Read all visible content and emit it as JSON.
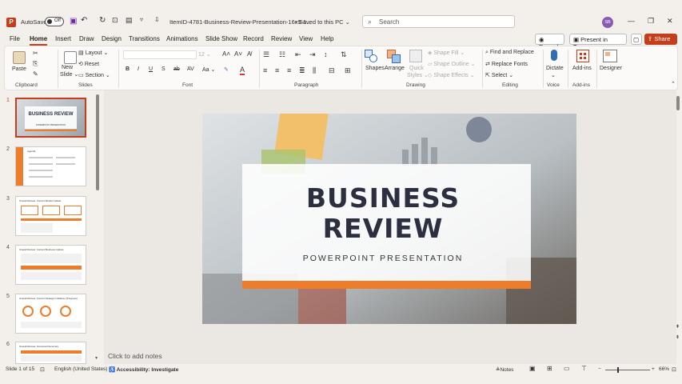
{
  "titlebar": {
    "autosave": "AutoSave",
    "toggle": "Off",
    "filename": "ItemID-4781-Business-Review-Presentation-16x9-1...",
    "saved": "Saved to this PC",
    "search_placeholder": "Search",
    "avatar": "SB"
  },
  "menu": [
    "File",
    "Home",
    "Insert",
    "Draw",
    "Design",
    "Transitions",
    "Animations",
    "Slide Show",
    "Record",
    "Review",
    "View",
    "Help"
  ],
  "actions": {
    "record": "Record",
    "present": "Present in Teams",
    "share": "Share"
  },
  "ribbon": {
    "paste": "Paste",
    "new_slide_1": "New",
    "new_slide_2": "Slide",
    "layout": "Layout",
    "reset": "Reset",
    "section": "Section",
    "font_size": "12",
    "shapes": "Shapes",
    "arrange": "Arrange",
    "quick_styles_1": "Quick",
    "quick_styles_2": "Styles",
    "shape_fill": "Shape Fill",
    "shape_outline": "Shape Outline",
    "shape_effects": "Shape Effects",
    "find_replace": "Find and Replace",
    "replace_fonts": "Replace Fonts",
    "select": "Select",
    "dictate": "Dictate",
    "addins": "Add-ins",
    "designer": "Designer",
    "groups": {
      "clipboard": "Clipboard",
      "slides": "Slides",
      "font": "Font",
      "paragraph": "Paragraph",
      "drawing": "Drawing",
      "editing": "Editing",
      "voice": "Voice",
      "addins": "Add-ins"
    }
  },
  "thumbnails": [
    {
      "num": "1",
      "title": "BUSINESS REVIEW",
      "subtitle": "POWERPOINT PRESENTATION"
    },
    {
      "num": "2",
      "title": "Agenda"
    },
    {
      "num": "3",
      "title": "Overall Review: Current Market Update"
    },
    {
      "num": "4",
      "title": "Overall Review: Current Business Update"
    },
    {
      "num": "5",
      "title": "Overall Review: Current Strategic Initiatives (Progress)"
    },
    {
      "num": "6",
      "title": "Overall Review: Scorecard Summary"
    }
  ],
  "slide": {
    "title_line1": "BUSINESS",
    "title_line2": "REVIEW",
    "subtitle": "POWERPOINT PRESENTATION"
  },
  "notes_placeholder": "Click to add notes",
  "status": {
    "slide_of": "Slide 1 of 15",
    "language": "English (United States)",
    "accessibility": "Accessibility: Investigate",
    "notes": "Notes",
    "zoom": "66%"
  },
  "colors": {
    "accent": "#c43e1c",
    "orange": "#ee7d2b",
    "title": "#2b2f3f"
  }
}
